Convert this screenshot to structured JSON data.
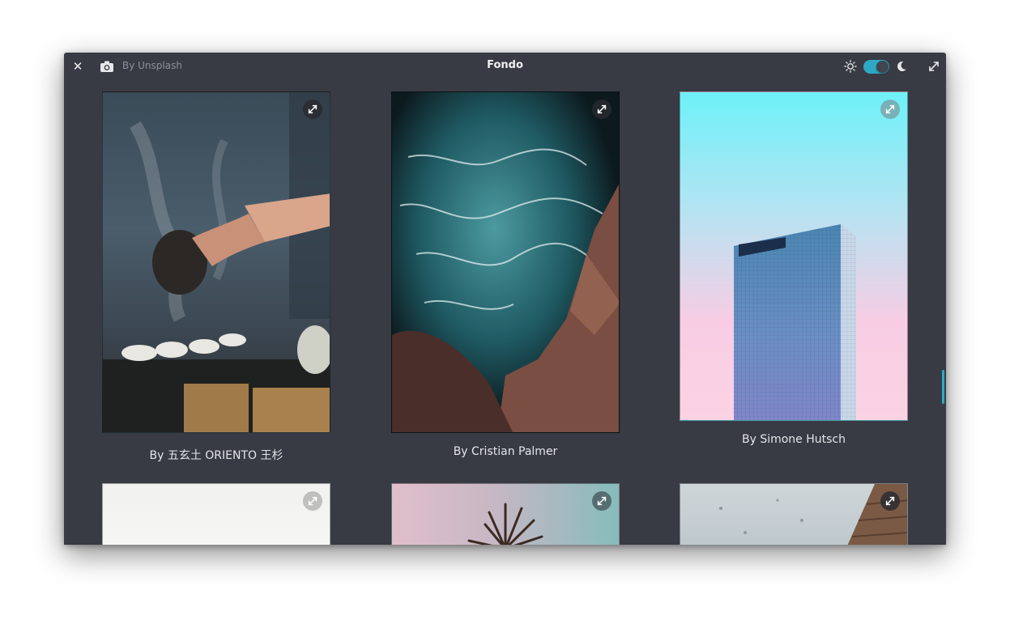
{
  "titlebar": {
    "title": "Fondo",
    "source_label": "By Unsplash",
    "close_icon": "close-icon",
    "camera_icon": "camera-icon",
    "sun_icon": "sun-icon",
    "moon_icon": "moon-icon",
    "maximize_icon": "maximize-icon",
    "dark_mode_enabled": true
  },
  "colors": {
    "window_bg": "#383b43",
    "accent": "#2ea9c4",
    "caption_text": "#e3e5ea"
  },
  "wallpapers": [
    {
      "caption": "By 五玄土 ORIENTO 王杉",
      "subject": "tea pouring"
    },
    {
      "caption": "By Cristian Palmer",
      "subject": "ocean waves and rocks"
    },
    {
      "caption": "By Simone Hutsch",
      "subject": "glass skyscraper"
    },
    {
      "caption": "",
      "subject": "white wall"
    },
    {
      "caption": "",
      "subject": "palm tree"
    },
    {
      "caption": "",
      "subject": "building corner"
    }
  ]
}
